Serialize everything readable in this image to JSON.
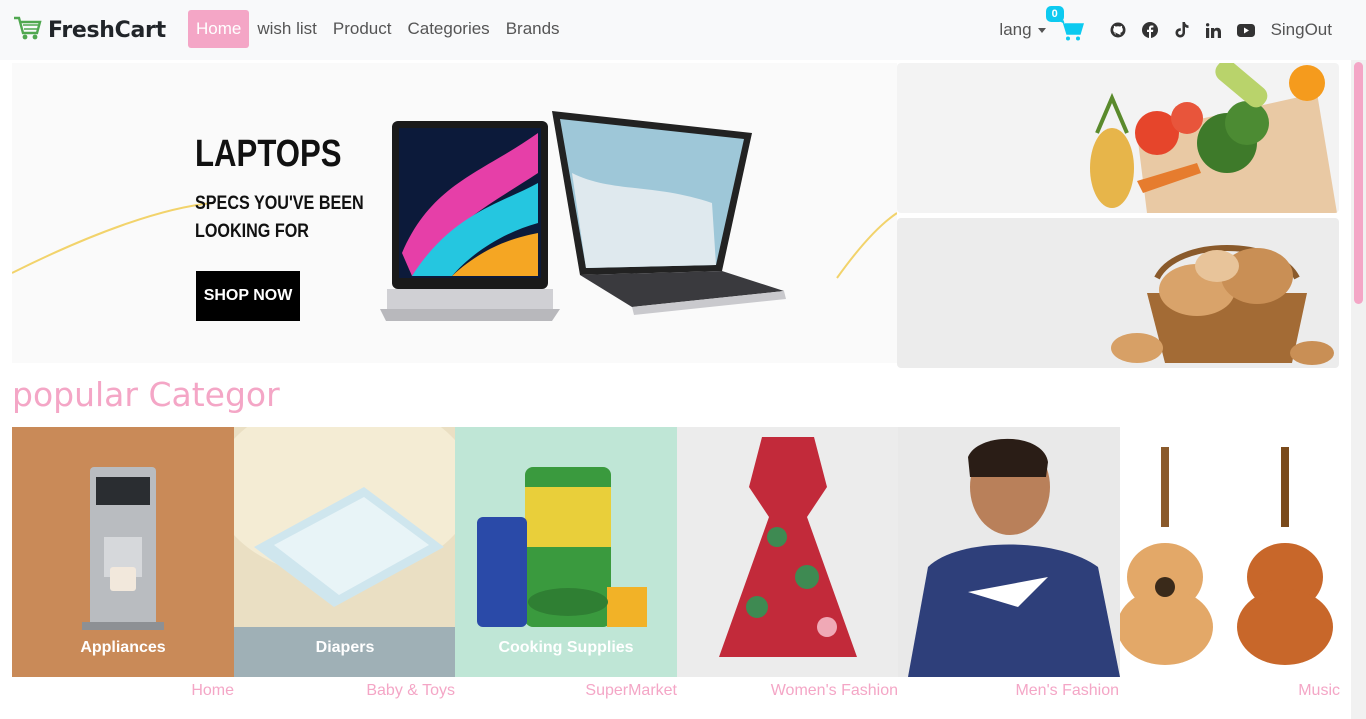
{
  "brand": {
    "name": "FreshCart"
  },
  "nav": {
    "links": [
      "Home",
      "wish list",
      "Product",
      "Categories",
      "Brands"
    ],
    "active": "Home"
  },
  "right_nav": {
    "lang": "lang",
    "cart_count": "0",
    "social_icons": [
      "github-icon",
      "facebook-icon",
      "tiktok-icon",
      "linkedin-icon",
      "youtube-icon"
    ],
    "signout": "SingOut"
  },
  "slider": {
    "title": "LAPTOPS",
    "subtitle": "SPECS YOU'VE BEEN LOOKING FOR",
    "cta": "SHOP NOW"
  },
  "categories_section": {
    "title": "popular Categor",
    "tiles": [
      {
        "image_label": "Appliances",
        "name": "Home",
        "bg": "#c98a58"
      },
      {
        "image_label": "Diapers",
        "name": "Baby & Toys",
        "bg": "#eadfc3"
      },
      {
        "image_label": "Cooking Supplies",
        "name": "SuperMarket",
        "bg": "#bfe6d6"
      },
      {
        "image_label": "",
        "name": "Women's Fashion",
        "bg": "#ececec"
      },
      {
        "image_label": "",
        "name": "Men's Fashion",
        "bg": "#e9e9e9"
      },
      {
        "image_label": "",
        "name": "Music",
        "bg": "#ffffff"
      }
    ]
  },
  "colors": {
    "accent": "#f4a6c6",
    "badge": "#0dcaf0",
    "cart": "#0dcaf0",
    "brand_icon": "#4fa74f"
  }
}
